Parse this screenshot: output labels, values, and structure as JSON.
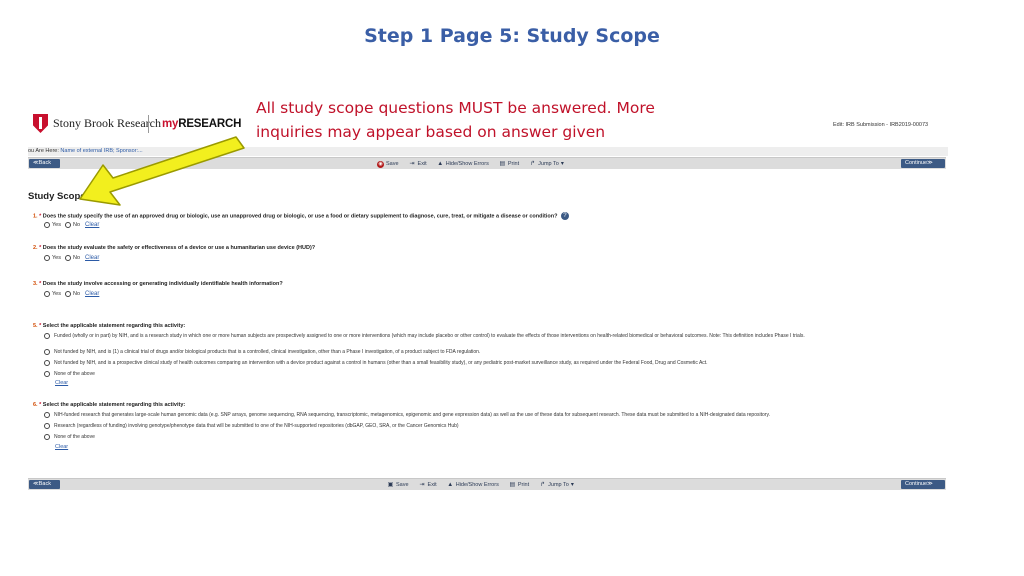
{
  "slide": {
    "title": "Step 1 Page 5: Study Scope",
    "callout_line1": "All study scope questions MUST be answered. More",
    "callout_line2": "inquiries may appear based on answer given"
  },
  "header": {
    "org_name": "Stony Brook Research",
    "app_name_my": "my",
    "app_name_rest": "RESEARCH",
    "edit_label": "Edit: IRB Submission - IRB2019-00073"
  },
  "breadcrumb": {
    "label": "ou Are Here:",
    "item": "Name of external IRB; Sponsor:..."
  },
  "toolbar": {
    "back_label": "≪Back",
    "continue_label": "Continue≫",
    "save_label": "Save",
    "exit_label": "Exit",
    "errors_label": "Hide/Show Errors",
    "print_label": "Print",
    "jump_label": "Jump To"
  },
  "page": {
    "section_title": "Study Scope"
  },
  "labels": {
    "yes": "Yes",
    "no": "No",
    "clear": "Clear"
  },
  "questions": [
    {
      "num": "1.",
      "text": "Does the study specify the use of an approved drug or biologic, use an unapproved drug or biologic, or use a food or dietary supplement to diagnose, cure, treat, or mitigate a disease or condition?"
    },
    {
      "num": "2.",
      "text": "Does the study evaluate the safety or effectiveness of a device or use a humanitarian use device (HUD)?"
    },
    {
      "num": "3.",
      "text": "Does the study involve accessing or generating individually identifiable health information?"
    },
    {
      "num": "5.",
      "text": "Select the applicable statement regarding this activity:",
      "options": [
        "Funded (wholly or in part) by NIH, and is a research study in which one or more human subjects are prospectively assigned to one or more interventions (which may include placebo or other control) to evaluate the effects of those interventions on health-related biomedical or behavioral outcomes. Note: This definition includes Phase I trials.",
        "Not funded by NIH, and is (1) a clinical trial of drugs and/or biological products that is a controlled, clinical investigation, other than a Phase I investigation, of a product subject to FDA regulation.",
        "Not funded by NIH, and is a prospective clinical study of health outcomes comparing an intervention with a device product against a control in humans (other than a small feasibility study), or any pediatric post-market surveillance study, as required under the Federal Food, Drug and Cosmetic Act.",
        "None of the above"
      ]
    },
    {
      "num": "6.",
      "text": "Select the applicable statement regarding this activity:",
      "options": [
        "NIH-funded research that generates large-scale human genomic data (e.g. SNP arrays, genome sequencing, RNA sequencing, transcriptomic, metagenomics, epigenomic and gene expression data) as well as the use of these data for subsequent research. These data must be submitted to a NIH-designated data repository.",
        "Research (regardless of funding) involving genotype/phenotype data that will be submitted to one of the NIH-supported repositories (dbGAP, GEO, SRA, or the Cancer Genomics Hub)",
        "None of the above"
      ]
    }
  ],
  "colors": {
    "title_blue": "#3a5ea6",
    "callout_red": "#c0122a",
    "arrow_yellow": "#f2ef1e",
    "button_blue": "#3c5a85"
  }
}
